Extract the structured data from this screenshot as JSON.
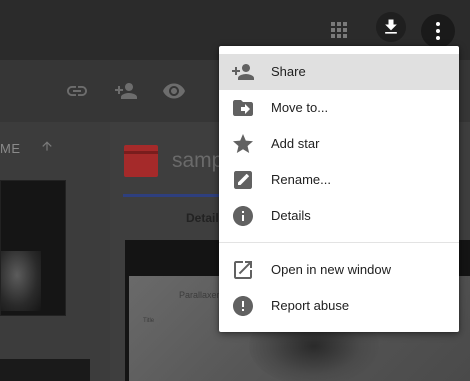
{
  "topbar": {
    "apps_icon": "grid-icon",
    "download_icon": "download-icon",
    "more_icon": "more-vert-icon"
  },
  "toolbar": {
    "icons": [
      "link-icon",
      "add-person-icon",
      "eye-icon"
    ]
  },
  "files": {
    "column_header": "ME",
    "sort_icon": "arrow-up-icon"
  },
  "details": {
    "file_title": "samp",
    "tab_label": "Detail",
    "preview_title": "Parallaxer – Fu",
    "preview_sub": "Title"
  },
  "menu": {
    "items": [
      {
        "label": "Share",
        "icon": "add-person-icon",
        "active": true
      },
      {
        "label": "Move to...",
        "icon": "move-folder-icon",
        "active": false
      },
      {
        "label": "Add star",
        "icon": "star-icon",
        "active": false
      },
      {
        "label": "Rename...",
        "icon": "rename-icon",
        "active": false
      },
      {
        "label": "Details",
        "icon": "info-icon",
        "active": false
      },
      {
        "label": "Open in new window",
        "icon": "open-external-icon",
        "active": false
      },
      {
        "label": "Report abuse",
        "icon": "report-icon",
        "active": false
      }
    ]
  },
  "colors": {
    "menu_icon": "#616161",
    "menu_text": "#212121",
    "active_row": "#e0e0e0",
    "file_icon": "#a52a2a",
    "tab_accent": "#2e3f7e"
  }
}
